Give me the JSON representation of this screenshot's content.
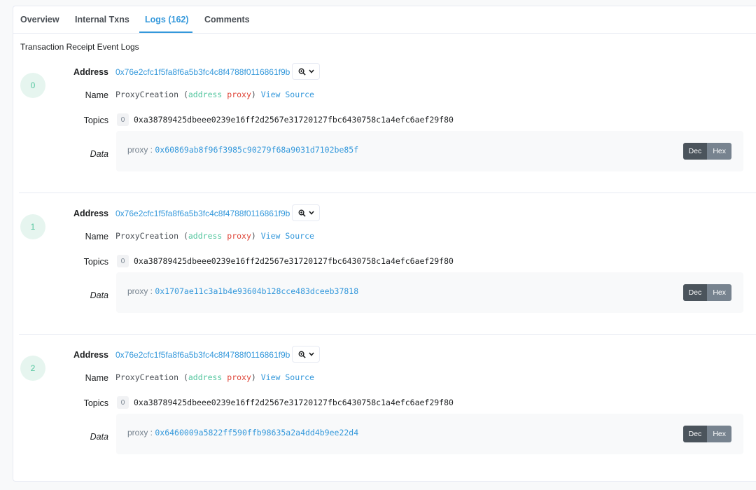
{
  "tabs": [
    {
      "label": "Overview",
      "active": false
    },
    {
      "label": "Internal Txns",
      "active": false
    },
    {
      "label": "Logs (162)",
      "active": true
    },
    {
      "label": "Comments",
      "active": false
    }
  ],
  "section_title": "Transaction Receipt Event Logs",
  "labels": {
    "address": "Address",
    "name": "Name",
    "topics": "Topics",
    "data": "Data"
  },
  "buttons": {
    "dec": "Dec",
    "hex": "Hex"
  },
  "icons": {
    "search": "zoom-in-icon",
    "chevron": "chevron-down-icon"
  },
  "colors": {
    "accent": "#3498db",
    "green": "#54c69f",
    "red": "#de4437"
  },
  "logs": [
    {
      "index": "0",
      "address": "0x76e2cfc1f5fa8f6a5b3fc4c8f4788f0116861f9b",
      "event_name": "ProxyCreation",
      "param_type": "address",
      "param_name": "proxy",
      "view_source": "View Source",
      "topic_index": "0",
      "topic_value": "0xa38789425dbeee0239e16ff2d2567e31720127fbc6430758c1a4efc6aef29f80",
      "data_key": "proxy :",
      "data_value": "0x60869ab8f96f3985c90279f68a9031d7102be85f"
    },
    {
      "index": "1",
      "address": "0x76e2cfc1f5fa8f6a5b3fc4c8f4788f0116861f9b",
      "event_name": "ProxyCreation",
      "param_type": "address",
      "param_name": "proxy",
      "view_source": "View Source",
      "topic_index": "0",
      "topic_value": "0xa38789425dbeee0239e16ff2d2567e31720127fbc6430758c1a4efc6aef29f80",
      "data_key": "proxy :",
      "data_value": "0x1707ae11c3a1b4e93604b128cce483dceeb37818"
    },
    {
      "index": "2",
      "address": "0x76e2cfc1f5fa8f6a5b3fc4c8f4788f0116861f9b",
      "event_name": "ProxyCreation",
      "param_type": "address",
      "param_name": "proxy",
      "view_source": "View Source",
      "topic_index": "0",
      "topic_value": "0xa38789425dbeee0239e16ff2d2567e31720127fbc6430758c1a4efc6aef29f80",
      "data_key": "proxy :",
      "data_value": "0x6460009a5822ff590ffb98635a2a4dd4b9ee22d4"
    }
  ]
}
